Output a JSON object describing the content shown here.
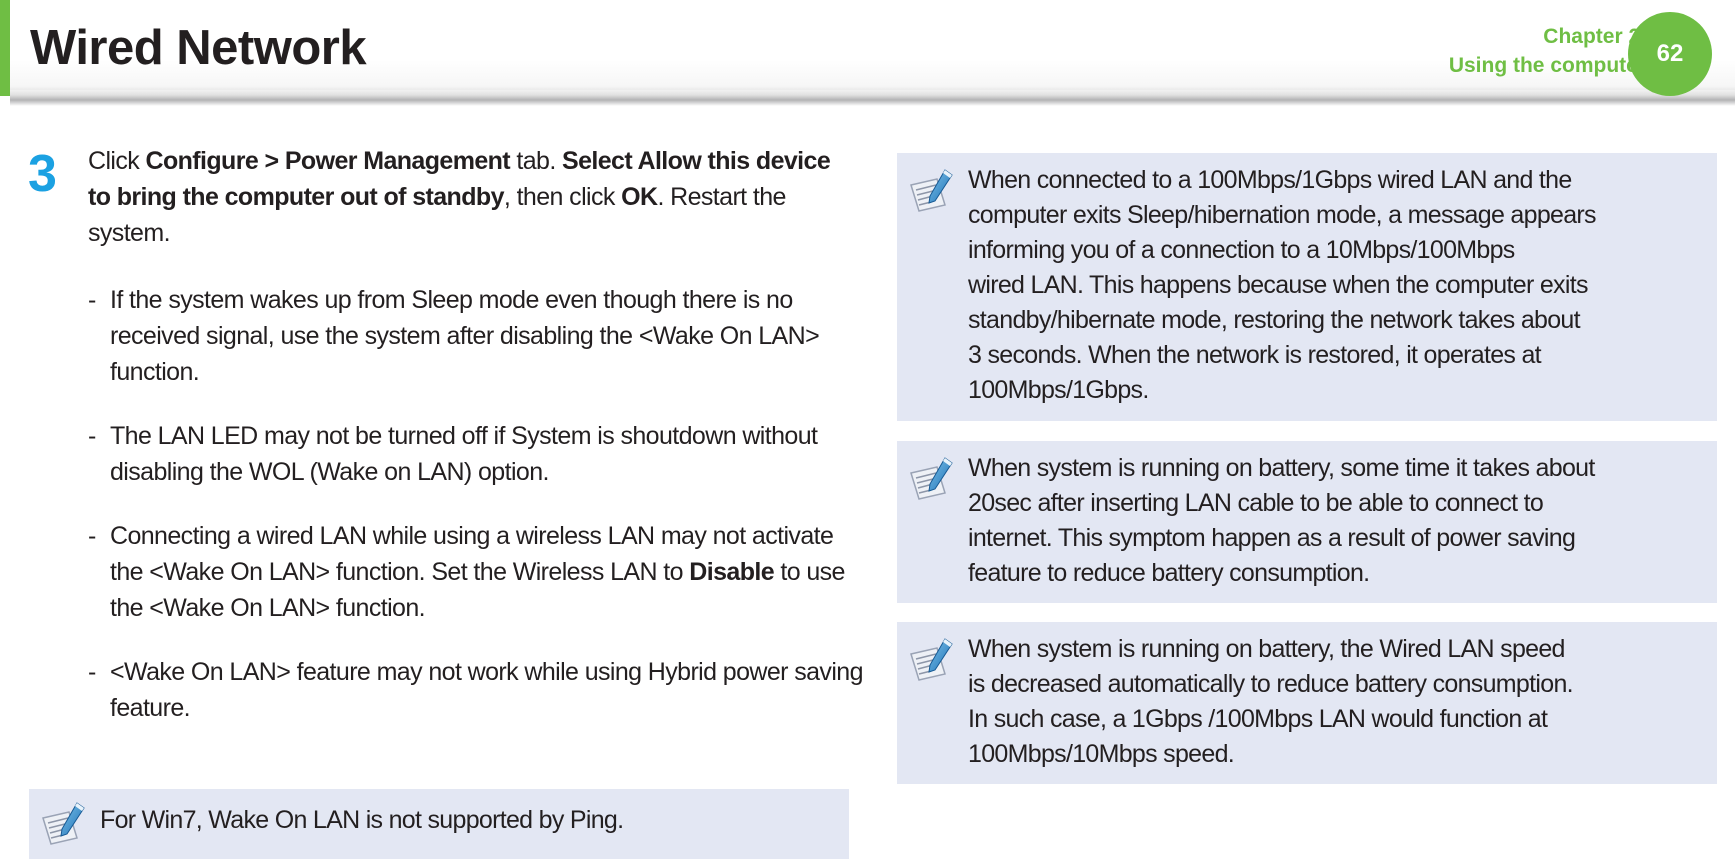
{
  "header": {
    "title": "Wired Network",
    "chapter_line1": "Chapter 2.",
    "chapter_line2": "Using the computer",
    "page_number": "62",
    "accent_color": "#6fbe44"
  },
  "step": {
    "number": "3",
    "number_color": "#1ba1e2",
    "segments": [
      {
        "text": "Click ",
        "bold": false
      },
      {
        "text": "Configure > Power Management",
        "bold": true
      },
      {
        "text": " tab. ",
        "bold": false
      },
      {
        "text": "Select Allow this  device to bring the computer out of standby",
        "bold": true
      },
      {
        "text": ", then click ",
        "bold": false
      },
      {
        "text": "OK",
        "bold": true
      },
      {
        "text": ". Restart the system.",
        "bold": false
      }
    ]
  },
  "bullets": [
    {
      "dash": "-",
      "segments": [
        {
          "text": "If the system wakes up from Sleep mode even though there is no received signal, use the system after disabling the <Wake On LAN> function.",
          "bold": false
        }
      ]
    },
    {
      "dash": "-",
      "segments": [
        {
          "text": "The LAN LED may not be turned off if System is shoutdown without disabling the WOL (Wake on LAN) option.",
          "bold": false
        }
      ]
    },
    {
      "dash": "-",
      "segments": [
        {
          "text": "Connecting a wired LAN while using a wireless LAN may not activate the <Wake On LAN> function. Set the Wireless LAN to ",
          "bold": false
        },
        {
          "text": "Disable",
          "bold": true
        },
        {
          "text": " to use the <Wake On LAN> function.",
          "bold": false
        }
      ]
    },
    {
      "dash": "-",
      "segments": [
        {
          "text": "<Wake On LAN> feature may not work while using Hybrid power saving feature.",
          "bold": false
        }
      ]
    }
  ],
  "notes": {
    "icon": "note-pencil-icon",
    "background": "#e3e7f3",
    "left": {
      "text": "For Win7, Wake On LAN is not supported by Ping."
    },
    "right": [
      {
        "lines": [
          "When connected to a 100Mbps/1Gbps wired LAN and the",
          "computer exits Sleep/hibernation mode, a message appears",
          "informing you of a connection to a 10Mbps/100Mbps",
          "wired LAN. This happens because when the computer exits",
          "standby/hibernate mode, restoring the network takes about",
          "3 seconds. When the network is restored, it operates at",
          "100Mbps/1Gbps."
        ]
      },
      {
        "lines": [
          "When system is running on battery, some time it takes about",
          "20sec after inserting LAN cable to be able to connect to",
          "internet. This symptom happen as a result of power saving",
          "feature to reduce battery consumption."
        ]
      },
      {
        "lines": [
          "When system is running on battery, the Wired LAN speed",
          "is decreased automatically to reduce battery consumption.",
          "In such case, a 1Gbps /100Mbps LAN would function at",
          "100Mbps/10Mbps speed."
        ]
      }
    ]
  }
}
